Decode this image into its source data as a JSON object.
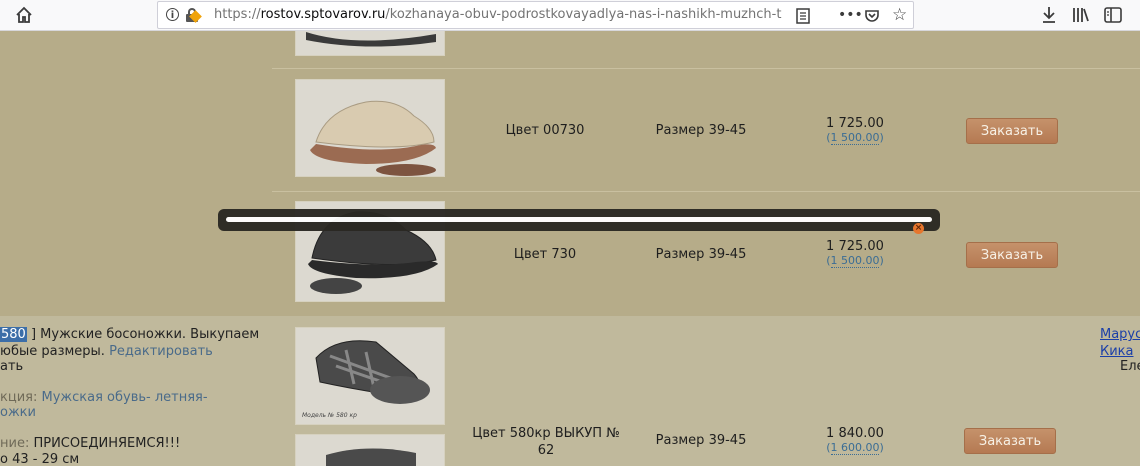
{
  "browser": {
    "url_domain": "rostov.sptovarov.ru",
    "url_prefix": "https://",
    "url_path": "/kozhanaya-obuv-podrostkovayadlya-nas-i-nashikh-muzhch-t",
    "icons": [
      "home-icon",
      "info-icon",
      "lock-warning-icon",
      "reader-icon",
      "more-icon",
      "pocket-icon",
      "bookmark-star-icon",
      "download-icon",
      "library-icon",
      "sidebar-icon"
    ]
  },
  "rows": [
    {
      "color": "Цвет 00730",
      "size": "Размер 39-45",
      "price": "1 725.00",
      "old_price": "1 500.00",
      "button": "Заказать"
    },
    {
      "color": "Цвет 730",
      "size": "Размер 39-45",
      "price": "1 725.00",
      "old_price": "1 500.00",
      "button": "Заказать"
    },
    {
      "color": "Цвет 580кр ВЫКУП № 62",
      "size": "Размер 39-45",
      "price": "1 840.00",
      "old_price": "1 600.00",
      "button": "Заказать"
    }
  ],
  "product": {
    "code": "580",
    "title_rest": " ] Мужские босоножки. Выкупаем",
    "line2": "юбые размеры.",
    "edit": "Редактировать",
    "line3": "ать",
    "section_label": "кция:",
    "section_value": "Мужская обувь- летняя-",
    "section_value2": "ожки",
    "note_label": "ние:",
    "note_value": "ПРИСОЕДИНЯЕМСЯ!!!",
    "note_line2": "о 43 - 29 см"
  },
  "right_links": [
    "Марус",
    "Кика",
    "Еле"
  ],
  "image_caption": "Модель № 580 кр"
}
